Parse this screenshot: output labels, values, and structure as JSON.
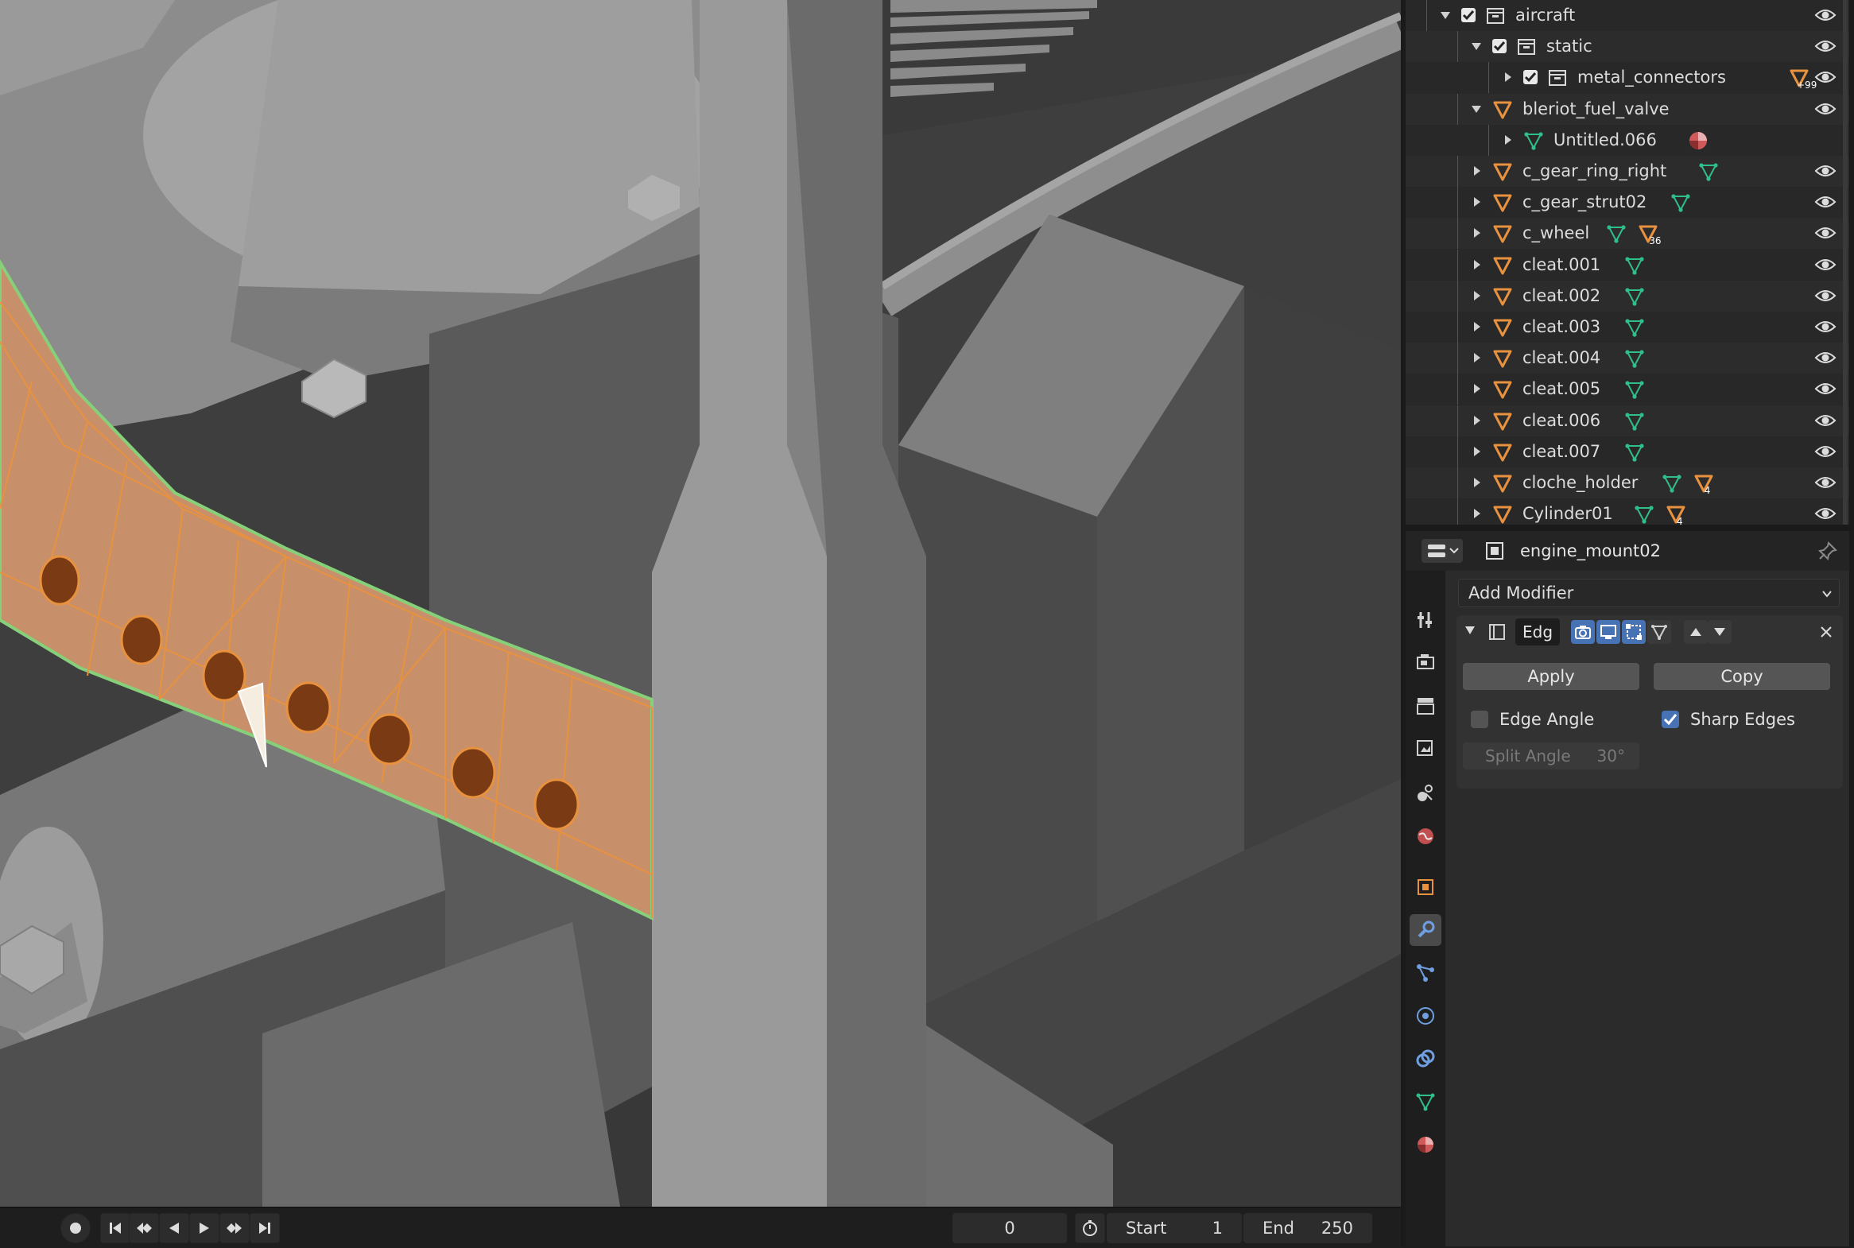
{
  "outliner": {
    "rows": [
      {
        "label": "aircraft",
        "type": "collection",
        "checked": true,
        "expanded": true,
        "eye": true
      },
      {
        "label": "static",
        "type": "collection",
        "checked": true,
        "expanded": true,
        "eye": true
      },
      {
        "label": "metal_connectors",
        "type": "collection",
        "checked": true,
        "expanded": false,
        "badge": "99",
        "eye": true
      },
      {
        "label": "bleriot_fuel_valve",
        "type": "object",
        "expanded": true,
        "eye": true
      },
      {
        "label": "Untitled.066",
        "type": "mesh",
        "expanded": false,
        "material": true,
        "eye": false
      },
      {
        "label": "c_gear_ring_right",
        "type": "object",
        "expanded": false,
        "eye": true
      },
      {
        "label": "c_gear_strut02",
        "type": "object",
        "expanded": false,
        "eye": true
      },
      {
        "label": "c_wheel",
        "type": "object",
        "expanded": false,
        "badge": "36",
        "eye": true
      },
      {
        "label": "cleat.001",
        "type": "object",
        "expanded": false,
        "eye": true
      },
      {
        "label": "cleat.002",
        "type": "object",
        "expanded": false,
        "eye": true
      },
      {
        "label": "cleat.003",
        "type": "object",
        "expanded": false,
        "eye": true
      },
      {
        "label": "cleat.004",
        "type": "object",
        "expanded": false,
        "eye": true
      },
      {
        "label": "cleat.005",
        "type": "object",
        "expanded": false,
        "eye": true
      },
      {
        "label": "cleat.006",
        "type": "object",
        "expanded": false,
        "eye": true
      },
      {
        "label": "cleat.007",
        "type": "object",
        "expanded": false,
        "eye": true
      },
      {
        "label": "cloche_holder",
        "type": "object",
        "expanded": false,
        "badge": "4",
        "eye": true
      },
      {
        "label": "Cylinder01",
        "type": "object",
        "expanded": false,
        "badge": "4",
        "eye": true
      }
    ]
  },
  "properties": {
    "object_name": "engine_mount02",
    "add_modifier_label": "Add Modifier",
    "modifier": {
      "name": "Edg",
      "apply_label": "Apply",
      "copy_label": "Copy",
      "edge_angle_label": "Edge Angle",
      "edge_angle_checked": false,
      "sharp_edges_label": "Sharp Edges",
      "sharp_edges_checked": true,
      "split_angle_label": "Split Angle",
      "split_angle_value": "30°"
    },
    "tabs": [
      "tool-icon",
      "render-icon",
      "output-icon",
      "view-layer-icon",
      "scene-icon",
      "world-icon",
      "object-icon",
      "modifier-icon",
      "particles-icon",
      "physics-icon",
      "constraints-icon",
      "data-icon",
      "material-icon"
    ],
    "active_tab": "modifier-icon"
  },
  "timeline": {
    "current_frame": "0",
    "start_label": "Start",
    "start_value": "1",
    "end_label": "End",
    "end_value": "250"
  },
  "colors": {
    "accent": "#4772b3",
    "object_orange": "#e8913e",
    "mesh_green": "#2fbf8a",
    "selection_orange": "#e8913e",
    "selection_edge_green": "#7ed67e"
  }
}
